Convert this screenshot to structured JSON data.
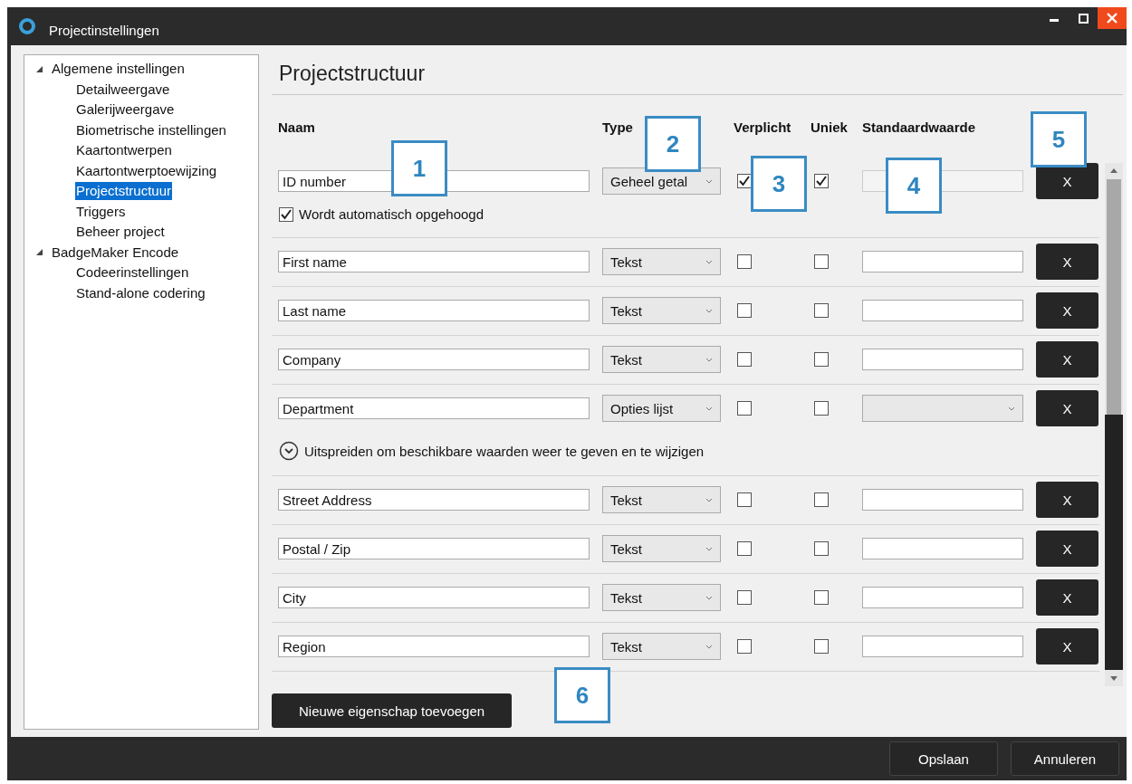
{
  "window": {
    "title": "Projectinstellingen"
  },
  "sidebar": {
    "items": [
      {
        "label": "Algemene instellingen",
        "selected": false,
        "expanded": true,
        "children": [
          {
            "label": "Detailweergave",
            "selected": false
          },
          {
            "label": "Galerijweergave",
            "selected": false
          },
          {
            "label": "Biometrische instellingen",
            "selected": false
          },
          {
            "label": "Kaartontwerpen",
            "selected": false
          },
          {
            "label": "Kaartontwerptoewijzing",
            "selected": false
          },
          {
            "label": "Projectstructuur",
            "selected": true
          },
          {
            "label": "Triggers",
            "selected": false
          },
          {
            "label": "Beheer project",
            "selected": false
          }
        ]
      },
      {
        "label": "BadgeMaker Encode",
        "selected": false,
        "expanded": true,
        "children": [
          {
            "label": "Codeerinstellingen",
            "selected": false
          },
          {
            "label": "Stand-alone codering",
            "selected": false
          }
        ]
      }
    ]
  },
  "heading": "Projectstructuur",
  "columns": [
    "Naam",
    "Type",
    "Verplicht",
    "Uniek",
    "Standaardwaarde"
  ],
  "rows": [
    {
      "name": "ID number",
      "type": "Geheel getal",
      "required": true,
      "unique": true,
      "default": {
        "kind": "text",
        "disabled": true
      },
      "auto_increment": {
        "label": "Wordt automatisch opgehoogd",
        "checked": true
      },
      "delete": "X"
    },
    {
      "name": "First name",
      "type": "Tekst",
      "required": false,
      "unique": false,
      "default": {
        "kind": "text",
        "disabled": false
      },
      "delete": "X"
    },
    {
      "name": "Last name",
      "type": "Tekst",
      "required": false,
      "unique": false,
      "default": {
        "kind": "text",
        "disabled": false
      },
      "delete": "X"
    },
    {
      "name": "Company",
      "type": "Tekst",
      "required": false,
      "unique": false,
      "default": {
        "kind": "text",
        "disabled": false
      },
      "delete": "X"
    },
    {
      "name": "Department",
      "type": "Opties lijst",
      "required": false,
      "unique": false,
      "default": {
        "kind": "select",
        "disabled": false
      },
      "expander": {
        "label": "Uitspreiden om beschikbare waarden weer te geven en te wijzigen"
      },
      "delete": "X"
    },
    {
      "name": "Street Address",
      "type": "Tekst",
      "required": false,
      "unique": false,
      "default": {
        "kind": "text",
        "disabled": false
      },
      "delete": "X"
    },
    {
      "name": "Postal / Zip",
      "type": "Tekst",
      "required": false,
      "unique": false,
      "default": {
        "kind": "text",
        "disabled": false
      },
      "delete": "X"
    },
    {
      "name": "City",
      "type": "Tekst",
      "required": false,
      "unique": false,
      "default": {
        "kind": "text",
        "disabled": false
      },
      "delete": "X"
    },
    {
      "name": "Region",
      "type": "Tekst",
      "required": false,
      "unique": false,
      "default": {
        "kind": "text",
        "disabled": false
      },
      "delete": "X"
    }
  ],
  "add_button": "Nieuwe eigenschap toevoegen",
  "footer_buttons": [
    "Opslaan",
    "Annuleren"
  ],
  "callouts": [
    "1",
    "2",
    "3",
    "4",
    "5",
    "6"
  ]
}
